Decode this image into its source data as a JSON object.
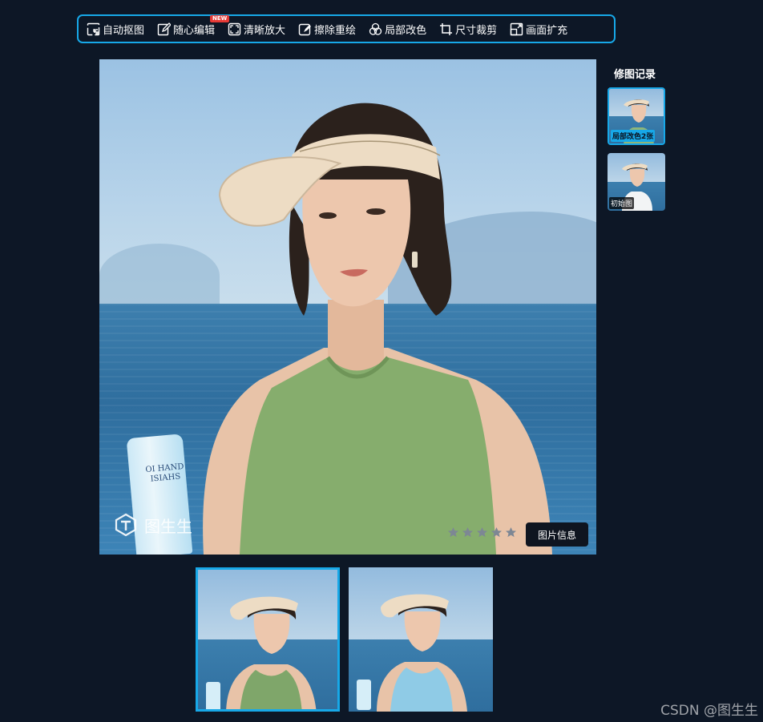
{
  "toolbar": {
    "items": [
      {
        "label": "自动抠图",
        "icon": "auto-matting-icon"
      },
      {
        "label": "随心编辑",
        "icon": "edit-icon",
        "badge": "NEW"
      },
      {
        "label": "清晰放大",
        "icon": "upscale-icon"
      },
      {
        "label": "擦除重绘",
        "icon": "erase-icon"
      },
      {
        "label": "局部改色",
        "icon": "recolor-icon"
      },
      {
        "label": "尺寸裁剪",
        "icon": "crop-icon"
      },
      {
        "label": "画面扩充",
        "icon": "expand-icon"
      }
    ]
  },
  "main_image": {
    "product_label_line1": "OI HAND",
    "product_label_line2": "ISIAHS",
    "watermark": "图生生",
    "info_button": "图片信息"
  },
  "history": {
    "title": "修图记录",
    "items": [
      {
        "label": "局部改色2张",
        "shirt_color": "#8fb57a"
      },
      {
        "label": "初始图",
        "shirt_color": "#f2f4f5"
      }
    ]
  },
  "variants": [
    {
      "shirt_color": "#7fa66a",
      "selected": true
    },
    {
      "shirt_color": "#8fcbe6",
      "selected": false
    }
  ],
  "footer": {
    "credit": "CSDN @图生生"
  },
  "colors": {
    "accent": "#17a8e8",
    "background": "#0d1726"
  }
}
